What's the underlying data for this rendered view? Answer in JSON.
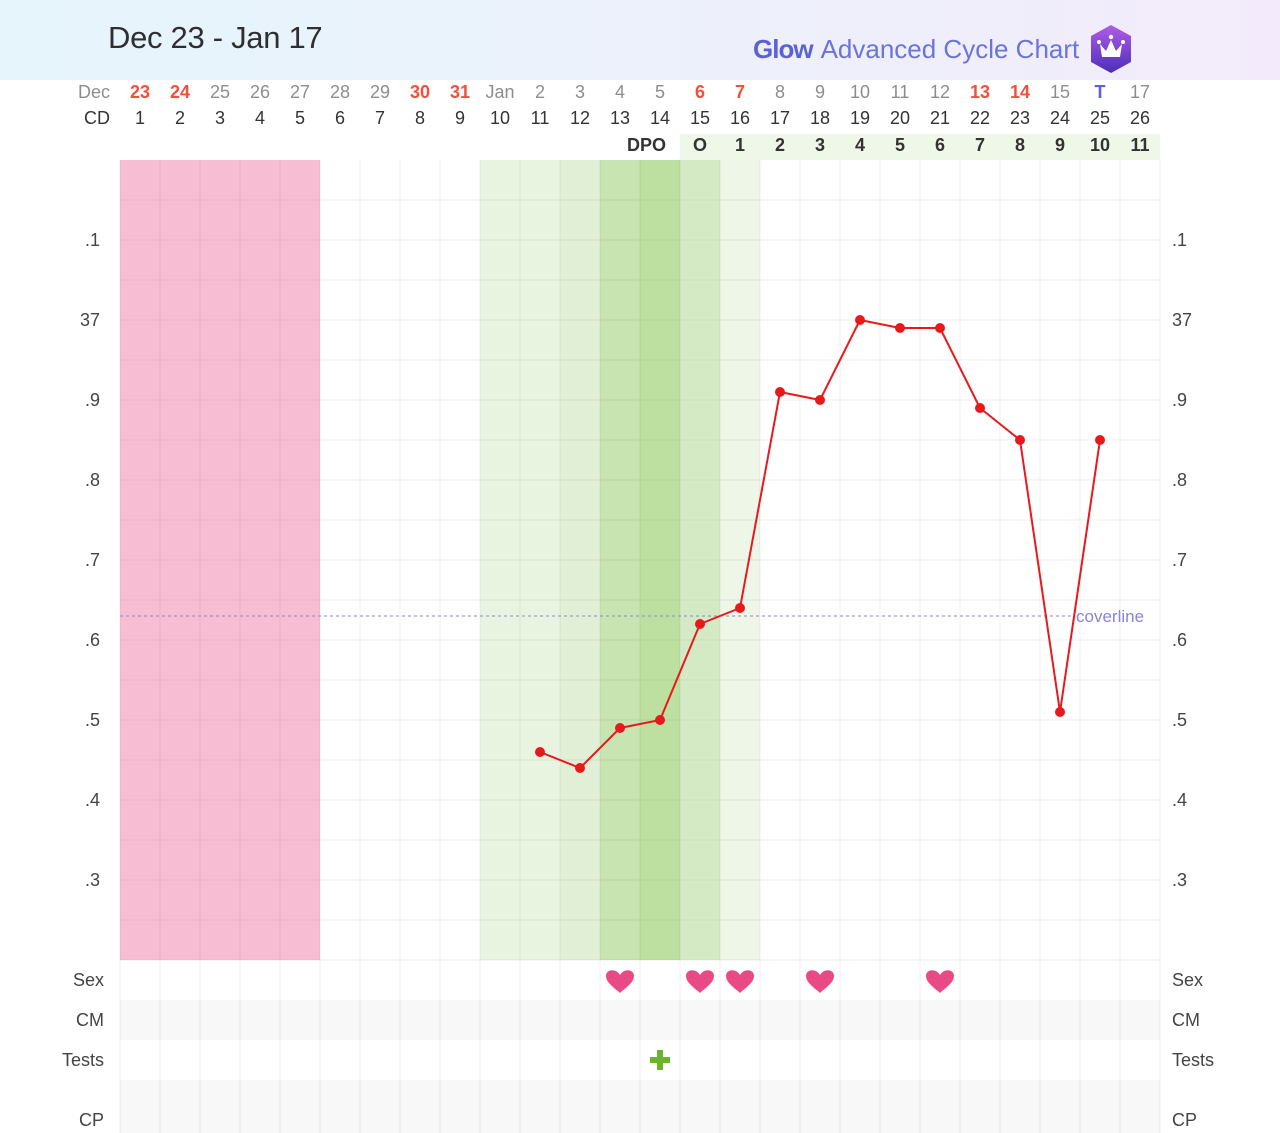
{
  "header": {
    "title": "Dec 23 - Jan 17",
    "brand_logo": "Glow",
    "brand_text": "Advanced Cycle Chart",
    "badge_icon": "crown-icon"
  },
  "rows": {
    "date_label": "Dec",
    "cd_label": "CD",
    "dpo_label": "DPO",
    "dates": [
      {
        "t": "23",
        "s": "red"
      },
      {
        "t": "24",
        "s": "red"
      },
      {
        "t": "25",
        "s": ""
      },
      {
        "t": "26",
        "s": ""
      },
      {
        "t": "27",
        "s": ""
      },
      {
        "t": "28",
        "s": ""
      },
      {
        "t": "29",
        "s": ""
      },
      {
        "t": "30",
        "s": "red"
      },
      {
        "t": "31",
        "s": "red"
      },
      {
        "t": "Jan",
        "s": ""
      },
      {
        "t": "2",
        "s": ""
      },
      {
        "t": "3",
        "s": ""
      },
      {
        "t": "4",
        "s": ""
      },
      {
        "t": "5",
        "s": ""
      },
      {
        "t": "6",
        "s": "red"
      },
      {
        "t": "7",
        "s": "red"
      },
      {
        "t": "8",
        "s": ""
      },
      {
        "t": "9",
        "s": ""
      },
      {
        "t": "10",
        "s": ""
      },
      {
        "t": "11",
        "s": ""
      },
      {
        "t": "12",
        "s": ""
      },
      {
        "t": "13",
        "s": "red"
      },
      {
        "t": "14",
        "s": "red"
      },
      {
        "t": "15",
        "s": ""
      },
      {
        "t": "T",
        "s": "today"
      },
      {
        "t": "17",
        "s": ""
      }
    ],
    "dpo": [
      "O",
      "1",
      "2",
      "3",
      "4",
      "5",
      "6",
      "7",
      "8",
      "9",
      "10",
      "11"
    ],
    "symptoms": [
      "Sex",
      "CM",
      "Tests",
      "CP"
    ]
  },
  "colors": {
    "period": "#f7bed3",
    "line": "#e8191c",
    "coverline": "#8a84d8",
    "heart": "#e94a86",
    "test_positive": "#6bb52a"
  },
  "chart_data": {
    "type": "line",
    "categories": [
      "1",
      "2",
      "3",
      "4",
      "5",
      "6",
      "7",
      "8",
      "9",
      "10",
      "11",
      "12",
      "13",
      "14",
      "15",
      "16",
      "17",
      "18",
      "19",
      "20",
      "21",
      "22",
      "23",
      "24",
      "25",
      "26"
    ],
    "values": [
      null,
      null,
      null,
      null,
      null,
      null,
      null,
      null,
      null,
      null,
      36.46,
      36.44,
      36.49,
      36.5,
      36.62,
      36.64,
      36.91,
      36.9,
      37.0,
      36.99,
      36.99,
      36.89,
      36.85,
      36.51,
      36.85,
      null
    ],
    "ylim": [
      36.2,
      37.2
    ],
    "ytick_values": [
      37.1,
      37.0,
      36.9,
      36.8,
      36.7,
      36.6,
      36.5,
      36.4,
      36.3
    ],
    "ytick_labels": [
      ".1",
      "37",
      ".9",
      ".8",
      ".7",
      ".6",
      ".5",
      ".4",
      ".3"
    ],
    "coverline": {
      "value": 36.63,
      "label": "coverline"
    },
    "period_days": [
      1,
      2,
      3,
      4,
      5
    ],
    "fertile_days": [
      {
        "cd": 10,
        "level": 1
      },
      {
        "cd": 11,
        "level": 1
      },
      {
        "cd": 12,
        "level": 2
      },
      {
        "cd": 13,
        "level": 4
      },
      {
        "cd": 14,
        "level": 5
      },
      {
        "cd": 15,
        "level": 3
      },
      {
        "cd": 16,
        "level": 0
      }
    ],
    "sex_days": [
      13,
      15,
      16,
      18,
      21
    ],
    "positive_test_days": [
      14
    ],
    "grid": true
  }
}
